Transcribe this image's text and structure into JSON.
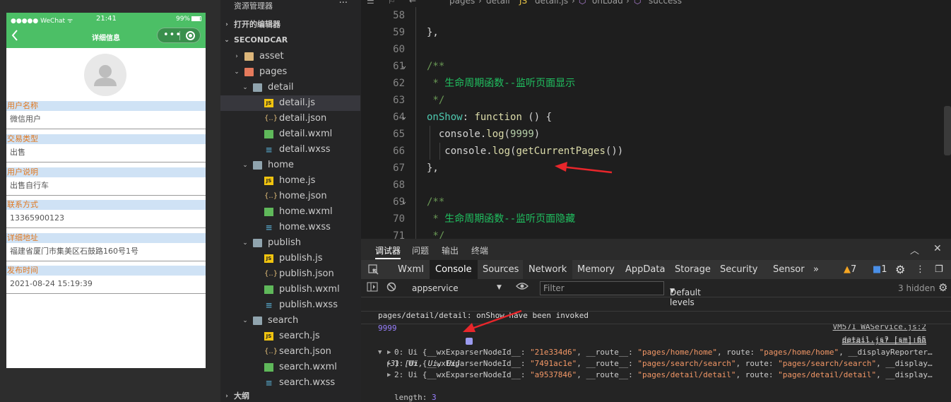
{
  "simulator": {
    "statusbar": {
      "carrier": "●●●●● WeChat",
      "wifi": "ᯤ",
      "time": "21:41",
      "battery": "99%"
    },
    "nav_title": "详细信息",
    "back_icon": "chevron-left-icon",
    "capsule_dots": "•••",
    "fields": [
      {
        "label": "用户名称",
        "value": "微信用户"
      },
      {
        "label": "交易类型",
        "value": "出售"
      },
      {
        "label": "用户说明",
        "value": "出售自行车"
      },
      {
        "label": "联系方式",
        "value": "13365900123"
      },
      {
        "label": "详细地址",
        "value": "福建省厦门市集美区石鼓路160号1号"
      },
      {
        "label": "发布时间",
        "value": "2021-08-24 15:19:39"
      }
    ],
    "colors": {
      "header": "#4cbf66",
      "label_bg": "#cfe2f5",
      "label_text": "#e07820"
    }
  },
  "explorer": {
    "title": "资源管理器",
    "more": "···",
    "open_editors": "打开的编辑器",
    "project": "SECONDCAR",
    "outline": "大纲",
    "tree": [
      {
        "label": "asset",
        "type": "folder",
        "depth": 1,
        "arrow": "›"
      },
      {
        "label": "pages",
        "type": "folder-red",
        "depth": 1,
        "arrow": "⌄"
      },
      {
        "label": "detail",
        "type": "folder-open",
        "depth": 2,
        "arrow": "⌄"
      },
      {
        "label": "detail.js",
        "type": "js",
        "depth": 3,
        "selected": true
      },
      {
        "label": "detail.json",
        "type": "json",
        "depth": 3
      },
      {
        "label": "detail.wxml",
        "type": "wxml",
        "depth": 3
      },
      {
        "label": "detail.wxss",
        "type": "wxss",
        "depth": 3
      },
      {
        "label": "home",
        "type": "folder-open",
        "depth": 2,
        "arrow": "⌄"
      },
      {
        "label": "home.js",
        "type": "js",
        "depth": 3
      },
      {
        "label": "home.json",
        "type": "json",
        "depth": 3
      },
      {
        "label": "home.wxml",
        "type": "wxml",
        "depth": 3
      },
      {
        "label": "home.wxss",
        "type": "wxss",
        "depth": 3
      },
      {
        "label": "publish",
        "type": "folder-open",
        "depth": 2,
        "arrow": "⌄"
      },
      {
        "label": "publish.js",
        "type": "js",
        "depth": 3
      },
      {
        "label": "publish.json",
        "type": "json",
        "depth": 3
      },
      {
        "label": "publish.wxml",
        "type": "wxml",
        "depth": 3
      },
      {
        "label": "publish.wxss",
        "type": "wxss",
        "depth": 3
      },
      {
        "label": "search",
        "type": "folder-open",
        "depth": 2,
        "arrow": "⌄"
      },
      {
        "label": "search.js",
        "type": "js",
        "depth": 3
      },
      {
        "label": "search.json",
        "type": "json",
        "depth": 3
      },
      {
        "label": "search.wxml",
        "type": "wxml",
        "depth": 3
      },
      {
        "label": "search.wxss",
        "type": "wxss",
        "depth": 3
      }
    ]
  },
  "editor": {
    "breadcrumb": [
      "pages",
      "detail",
      "detail.js",
      "onLoad",
      "success"
    ],
    "lines": [
      {
        "n": "58",
        "html": ""
      },
      {
        "n": "59",
        "html": "<span class='k-punc'>},</span>"
      },
      {
        "n": "60",
        "html": ""
      },
      {
        "n": "61",
        "fold": true,
        "html": "<span class='k-com'>/**</span>"
      },
      {
        "n": "62",
        "html": "<span class='k-com'> * </span><span class='k-cn'>生命周期函数--监听页面显示</span>"
      },
      {
        "n": "63",
        "html": "<span class='k-com'> */</span>"
      },
      {
        "n": "64",
        "fold": true,
        "html": "<span class='k-fn'>onShow</span><span class='k-punc'>: </span><span class='k-key'>function</span><span class='k-punc'> () {</span>"
      },
      {
        "n": "65",
        "html": "<span class='k-punc'>  console.</span><span class='k-key'>log</span><span class='k-punc'>(</span><span class='k-num'>9999</span><span class='k-punc'>)</span>"
      },
      {
        "n": "66",
        "html": "<span class='k-punc'>   console.</span><span class='k-key'>log</span><span class='k-punc'>(</span><span class='k-key'>getCurrentPages</span><span class='k-punc'>())</span>"
      },
      {
        "n": "67",
        "html": "<span class='k-punc'>},</span>"
      },
      {
        "n": "68",
        "html": ""
      },
      {
        "n": "69",
        "fold": true,
        "html": "<span class='k-com'>/**</span>"
      },
      {
        "n": "70",
        "html": "<span class='k-com'> * </span><span class='k-cn'>生命周期函数--监听页面隐藏</span>"
      },
      {
        "n": "71",
        "html": "<span class='k-com'> */</span>"
      }
    ]
  },
  "devtools": {
    "top_tabs": [
      "调试器",
      "问题",
      "输出",
      "终端"
    ],
    "panel_tabs": [
      "Wxml",
      "Console",
      "Sources",
      "Network",
      "Memory",
      "AppData",
      "Storage",
      "Security",
      "Sensor"
    ],
    "more_tabs": "»",
    "warnings": "7",
    "errors": "1",
    "context": "appservice",
    "filter_placeholder": "Filter",
    "levels": "Default levels",
    "hidden": "3 hidden",
    "console": {
      "msg1": "pages/detail/detail: onShow have been invoked",
      "src1": "VM571 WAService.js:2",
      "num": "9999",
      "src2": "detail.js? [sm]:65",
      "src3": "detail.js? [sm]:66",
      "arr_head": "(3) [Ui, Ui, Ui]",
      "items": [
        {
          "idx": "0",
          "id": "\"21e334d6\"",
          "route": "\"pages/home/home\"",
          "tail": "__displayReporter…"
        },
        {
          "idx": "1",
          "id": "\"7491ac1e\"",
          "route": "\"pages/search/search\"",
          "tail": "__display…"
        },
        {
          "idx": "2",
          "id": "\"a9537846\"",
          "route": "\"pages/detail/detail\"",
          "tail": "__display…"
        }
      ],
      "length": "3",
      "nv_length": "(...)"
    }
  }
}
